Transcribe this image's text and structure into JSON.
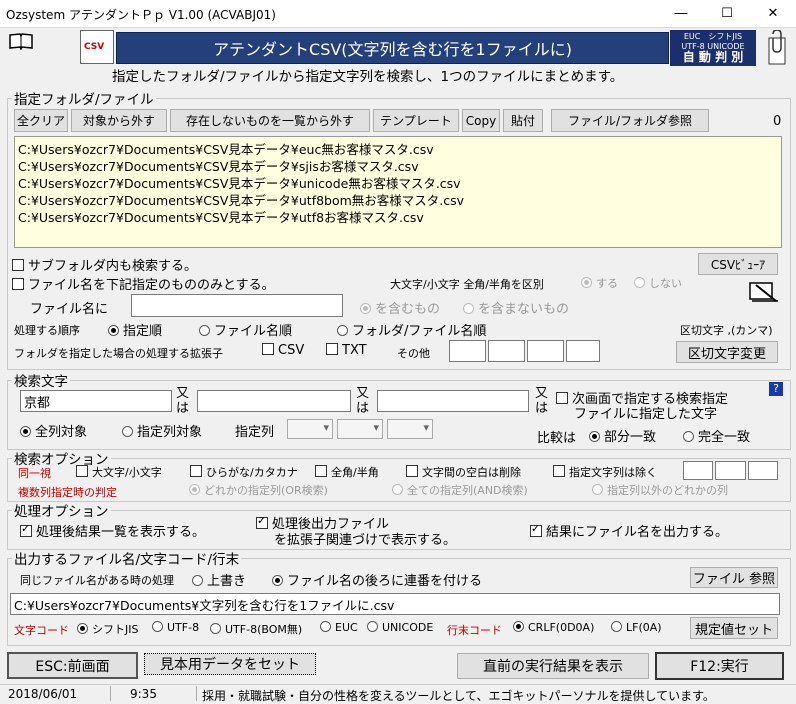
{
  "window": {
    "title": "Ozsystem アテンダントＰｐ V1.00 (ACVABJ01)"
  },
  "header": {
    "banner": "アテンダントCSV(文字列を含む行を1ファイルに)",
    "subtitle": "指定したフォルダ/ファイルから指定文字列を検索し、1つのファイルにまとめます。",
    "csv_icon": "CSV",
    "logo": {
      "l1": "EUC　シフトJIS",
      "l2": "UTF-8 UNICODE",
      "l3": "自 動 判 別"
    }
  },
  "folder": {
    "legend": "指定フォルダ/ファイル",
    "buttons": {
      "clear_all": "全クリア",
      "remove": "対象から外す",
      "remove_missing": "存在しないものを一覧から外す",
      "template": "テンプレート",
      "copy": "Copy",
      "paste": "貼付",
      "browse": "ファイル/フォルダ参照"
    },
    "count": "0",
    "files": [
      "C:¥Users¥ozcr7¥Documents¥CSV見本データ¥euc無お客様マスタ.csv",
      "C:¥Users¥ozcr7¥Documents¥CSV見本データ¥sjisお客様マスタ.csv",
      "C:¥Users¥ozcr7¥Documents¥CSV見本データ¥unicode無お客様マスタ.csv",
      "C:¥Users¥ozcr7¥Documents¥CSV見本データ¥utf8bom無お客様マスタ.csv",
      "C:¥Users¥ozcr7¥Documents¥CSV見本データ¥utf8お客様マスタ.csv"
    ],
    "subfolder": "サブフォルダ内も検索する。",
    "filename_only": "ファイル名を下記指定のもののみとする。",
    "case_label": "大文字/小文字 全角/半角を区別",
    "case_yes": "する",
    "case_no": "しない",
    "csv_viewer": "CSVﾋﾞｭｰｱ",
    "filename_label": "ファイル名に",
    "contains": "を含むもの",
    "not_contains": "を含まないもの",
    "order_label": "処理する順序",
    "order_opts": [
      "指定順",
      "ファイル名順",
      "フォルダ/ファイル名順"
    ],
    "delim_label": "区切文字 ,(カンマ)",
    "ext_label": "フォルダを指定した場合の処理する拡張子",
    "ext_csv": "CSV",
    "ext_txt": "TXT",
    "ext_other": "その他",
    "delim_change": "区切文字変更"
  },
  "search": {
    "legend": "検索文字",
    "term1": "京都",
    "or1": "又は",
    "or2": "又は",
    "or3": "又は",
    "next_screen": "次画面で指定する検索指定",
    "next_screen2": "ファイルに指定した文字",
    "all_cols": "全列対象",
    "spec_cols": "指定列対象",
    "col_label": "指定列",
    "compare_label": "比較は",
    "partial": "部分一致",
    "exact": "完全一致"
  },
  "search_opt": {
    "legend": "検索オプション",
    "same": "同一視",
    "case": "大文字/小文字",
    "kana": "ひらがな/カタカナ",
    "width": "全角/半角",
    "spaces": "文字間の空白は削除",
    "exclude": "指定文字列は除く",
    "multi_label": "複数列指定時の判定",
    "any_col": "どれかの指定列(OR検索)",
    "all_col": "全ての指定列(AND検索)",
    "other_col": "指定列以外のどれかの列"
  },
  "proc_opt": {
    "legend": "処理オプション",
    "show_list": "処理後結果一覧を表示する。",
    "show_output1": "処理後出力ファイル",
    "show_output2": "を拡張子関連づけで表示する。",
    "output_fname": "結果にファイル名を出力する。"
  },
  "output": {
    "legend": "出力するファイル名/文字コード/行末",
    "same_label": "同じファイル名がある時の処理",
    "overwrite": "上書き",
    "serial": "ファイル名の後ろに連番を付ける",
    "browse": "ファイル 参照",
    "path": "C:¥Users¥ozcr7¥Documents¥文字列を含む行を1ファイルに.csv",
    "enc_label": "文字コード",
    "encodings": [
      "シフトJIS",
      "UTF-8",
      "UTF-8(BOM無)",
      "EUC",
      "UNICODE"
    ],
    "eol_label": "行末コード",
    "eols": [
      "CRLF(0D0A)",
      "LF(0A)"
    ],
    "defaults": "規定値セット"
  },
  "footer": {
    "esc": "ESC:前画面",
    "sample": "見本用データをセット",
    "last_result": "直前の実行結果を表示",
    "run": "F12:実行"
  },
  "status": {
    "date": "2018/06/01",
    "time": "9:35",
    "message": "採用・就職試験・自分の性格を変えるツールとして、エゴキットパーソナルを提供しています。"
  }
}
